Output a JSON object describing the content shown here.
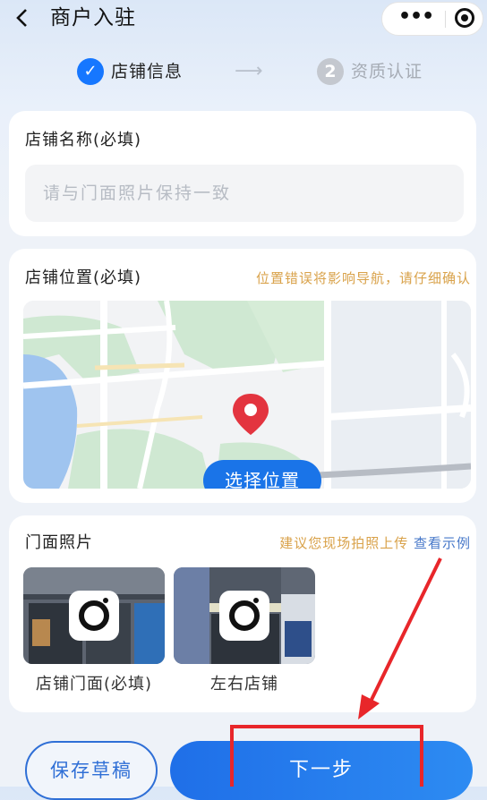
{
  "nav": {
    "back_icon": "chevron-left-icon",
    "title": "商户入驻",
    "more_icon": "more-dots-icon",
    "close_icon": "target-circle-icon"
  },
  "steps": [
    {
      "label": "店铺信息",
      "icon": "check-circle-icon",
      "state": "active"
    },
    {
      "label": "资质认证",
      "number": "2",
      "state": "inactive"
    }
  ],
  "store_name": {
    "label": "店铺名称(必填)",
    "placeholder": "请与门面照片保持一致",
    "value": ""
  },
  "store_location": {
    "label": "店铺位置(必填)",
    "hint": "位置错误将影响导航，请仔细确认",
    "select_button": "选择位置",
    "pin_icon": "location-pin-icon"
  },
  "storefront_photos": {
    "label": "门面照片",
    "hint": "建议您现场拍照上传",
    "hint_link": "查看示例",
    "tiles": [
      {
        "label": "店铺门面(必填)",
        "icon": "camera-icon"
      },
      {
        "label": "左右店铺",
        "icon": "camera-icon"
      }
    ]
  },
  "footer": {
    "save_draft": "保存草稿",
    "next": "下一步"
  },
  "colors": {
    "primary": "#1a74e8",
    "hint": "#d9a24a",
    "annotation": "#e8262a"
  }
}
